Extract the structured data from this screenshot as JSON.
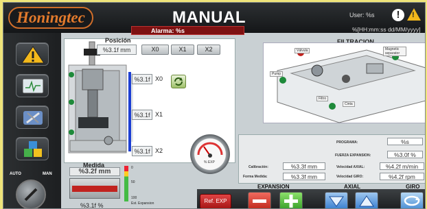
{
  "header": {
    "logo": "Honingtec",
    "title": "MANUAL",
    "alarm": "Alarma: %s",
    "user": "User: %s",
    "datetime": "%[HH:mm:ss dd/MM/yyyy]"
  },
  "sidebar": {
    "auto": "AUTO",
    "man": "MAN"
  },
  "posicion": {
    "label": "Posición",
    "value": "%3.1f mm",
    "buttons": [
      "X0",
      "X1",
      "X2"
    ],
    "axis_values": [
      "%3.1f",
      "%3.1f",
      "%3.1f"
    ],
    "axis_labels": [
      "X0",
      "X1",
      "X2"
    ]
  },
  "medida": {
    "label": "Medida",
    "value": "%3.2f mm",
    "percent": "%3.1f %",
    "scale_top": "0",
    "scale_mid": "50",
    "scale_low": "100",
    "scale_caption": "Est. Expansion"
  },
  "dial": {
    "caption": "% EXP"
  },
  "filtracion": {
    "label": "FILTRACION",
    "tags": [
      "Válvula",
      "Magnetic separator",
      "Pump",
      "Filtro",
      "Cinta"
    ]
  },
  "programa": {
    "programa_label": "PROGRAMA:",
    "programa_value": "%s",
    "fuerza_label": "FUERZA EXPANSION:",
    "fuerza_value": "%3.0f %",
    "calibracion_label": "Calibración:",
    "calibracion_value": "%3.3f mm",
    "vel_axial_label": "Velocidad AXIAL:",
    "vel_axial_value": "%4.2f m/min",
    "forma_label": "Forma Medida:",
    "forma_value": "%3.3f mm",
    "vel_giro_label": "Velocidad GIRO:",
    "vel_giro_value": "%4.2f rpm"
  },
  "controls": {
    "expansion": "EXPANSION",
    "axial": "AXIAL",
    "giro": "GIRO",
    "ref_exp": "Ref. EXP"
  },
  "colors": {
    "accent_orange": "#e27a2c",
    "alarm_red": "#7d1111",
    "warning_yellow": "#f3b81b",
    "position_blue": "#1d3fd3"
  }
}
